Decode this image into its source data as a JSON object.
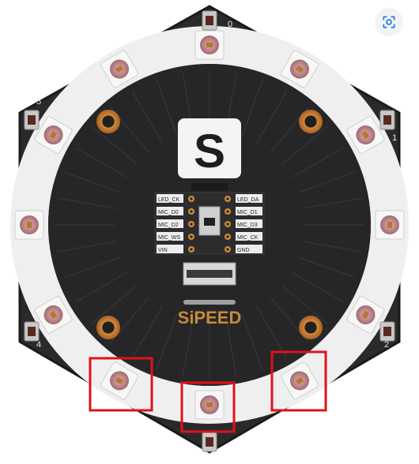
{
  "image": {
    "kind": "photo",
    "subject": "sipeed-hexagon-led-mic-board"
  },
  "board": {
    "brand": "SiPEED",
    "logo_letter": "S",
    "left_pin_labels": [
      "LED_CK",
      "MIC_D0",
      "MIC_D2",
      "MIC_WS",
      "VIN"
    ],
    "right_pin_labels": [
      "LED_DA",
      "MIC_D1",
      "MIC_D3",
      "MIC_CK",
      "GND"
    ],
    "mic_numbers": [
      "0",
      "1",
      "2",
      "4",
      "5"
    ]
  },
  "overlay": {
    "highlight_color": "#e0111b",
    "highlight_count": 3
  },
  "ui": {
    "lens_icon": "lens-icon"
  }
}
